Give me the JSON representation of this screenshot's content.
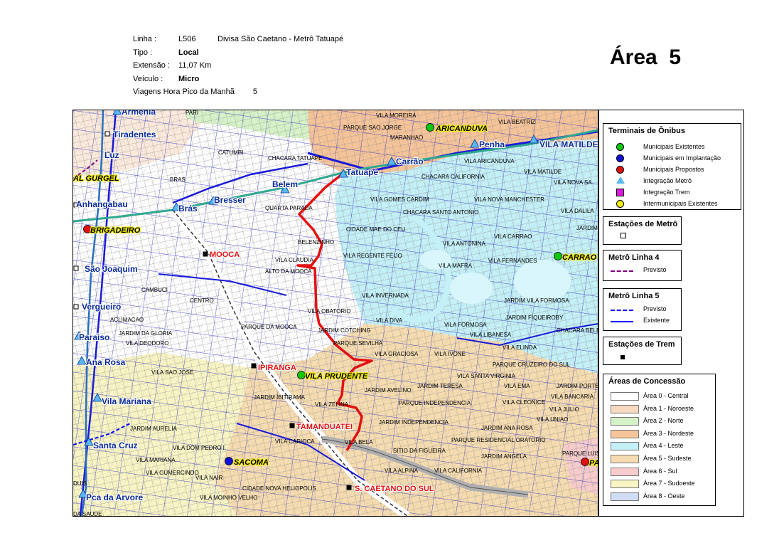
{
  "header": {
    "linha_label": "Linha :",
    "linha_code": "L506",
    "linha_name": "Divisa São Caetano - Metrô Tatuapé",
    "tipo_label": "Tipo :",
    "tipo_value": "Local",
    "extensao_label": "Extensão :",
    "extensao_value": "11,07",
    "extensao_unit": "Km",
    "veiculo_label": "Veículo :",
    "veiculo_value": "Micro",
    "viagens_label": "Viagens Hora Pico da Manhã",
    "viagens_value": "5"
  },
  "area_title": "Área  5",
  "map": {
    "stations": [
      {
        "name": "Armenia",
        "type": "metro"
      },
      {
        "name": "Tiradentes",
        "type": "metro-square"
      },
      {
        "name": "Luz",
        "type": "metro-square"
      },
      {
        "name": "AL GURGEL",
        "type": "terminal-label"
      },
      {
        "name": "Anhangabau",
        "type": "metro-square"
      },
      {
        "name": "Brás",
        "type": "metro"
      },
      {
        "name": "Bresser",
        "type": "metro"
      },
      {
        "name": "Belem",
        "type": "metro"
      },
      {
        "name": "Tatuape",
        "type": "metro"
      },
      {
        "name": "Carrão",
        "type": "metro"
      },
      {
        "name": "Penha",
        "type": "metro"
      },
      {
        "name": "VILA MATILDE",
        "type": "metro"
      },
      {
        "name": "São Joaquim",
        "type": "metro-square"
      },
      {
        "name": "Vergueiro",
        "type": "metro-square"
      },
      {
        "name": "Paraiso",
        "type": "metro"
      },
      {
        "name": "Ana Rosa",
        "type": "metro"
      },
      {
        "name": "Vila Mariana",
        "type": "metro"
      },
      {
        "name": "Santa Cruz",
        "type": "metro"
      },
      {
        "name": "Pca da Arvore",
        "type": "metro"
      }
    ],
    "terminals": [
      {
        "name": "ARICANDUVA",
        "color": "green"
      },
      {
        "name": "BRIGADEIRO",
        "color": "red"
      },
      {
        "name": "CARRAO",
        "color": "green"
      },
      {
        "name": "VILA PRUDENTE",
        "color": "green"
      },
      {
        "name": "SACOMA",
        "color": "blue"
      },
      {
        "name": "PA",
        "color": "red"
      }
    ],
    "train_stations": [
      "MOOCA",
      "IPIRANGA",
      "TAMANDUATEI",
      "S. CAETANO DO SUL"
    ],
    "neighborhoods": [
      "VILA MOREIRA",
      "PARQUE SAO JORGE",
      "MARANHAO",
      "VILA BEATRIZ",
      "PARI",
      "CATUMBI",
      "CHACARA TATUAPE",
      "BRAS",
      "QUARTA PARADA",
      "VILA ARICANDUVA",
      "CHACARA CALIFORNIA",
      "VILA MATILDE",
      "VILA NOVA SA",
      "VILA GOMES CARDIM",
      "VILA NOVA MANCHESTER",
      "CHACARA SANTO ANTONIO",
      "VILA DALILA",
      "CIDADE MAE DO CEU",
      "BELENZINHO",
      "VILA REGENTE FEIJO",
      "VILA ANTONINA",
      "VILA CARRAO",
      "JARDIM",
      "VILA CLAUDIA",
      "ALTO DA MOOCA",
      "VILA MAFRA",
      "VILA FERNANDES",
      "CAMBUCI",
      "CENTRO",
      "VILA INVERNADA",
      "JARDIM VILA FORMOSA",
      "ACLIMACAO",
      "VILA OBATORIO",
      "PARQUE DA MOOCA",
      "VILA DIVA",
      "VILA FORMOSA",
      "JARDIM FIQUEIROBY",
      "JARDIM COTCHING",
      "VILA LIBANESA",
      "CHACARA BELENZINHO",
      "JARDIM DA GLORIA",
      "VILA DEODORO",
      "PARQUE SEVILHA",
      "VILA GRACIOSA",
      "VILA IVONE",
      "VILA ELINDA",
      "PARQUE CRUZEIRO DO SUL",
      "VILA SAO JOSE",
      "VILA SANTA VIRGINIA",
      "JARDIM TERESA",
      "VILA EMA",
      "JARDIM PORTEIRA GRANDE",
      "JARDIM IBITIRAMA",
      "JARDIM AVELINO",
      "PARQUE INDEPENDENCIA",
      "VILA CLEONICE",
      "VILA BANCARIA",
      "VILA ZELINA",
      "VILA JULIO",
      "JARDIM AURELIA",
      "JARDIM INDEPENDENCIA",
      "JARDIM ANA ROSA",
      "VILA UNIAO",
      "VILA DOM PEDRO I",
      "VILA CARIOCA",
      "VILA BELA",
      "PARQUE RESIDENCIAL ORATORIO",
      "SITIO DA FIGUEIRA",
      "JARDIM ANGELA",
      "PARQUE LUIS MO",
      "VILA MARIANA",
      "VILA GUMERCINDO",
      "VILA NAIR",
      "VILA ALPINA",
      "VILA CALIFORNIA",
      "CIDADE NOVA HELIOPOLIS",
      "VILA MOINHO VELHO",
      "DA SAUDE",
      "DUIS"
    ]
  },
  "legend": {
    "terminais": {
      "title": "Terminais de Ônibus",
      "items": [
        {
          "label": "Municipais Existentes",
          "color": "#10c810",
          "shape": "circle"
        },
        {
          "label": "Municipais em Implantação",
          "color": "#1010d8",
          "shape": "circle"
        },
        {
          "label": "Municipais Propostos",
          "color": "#e01010",
          "shape": "circle"
        },
        {
          "label": "Integração Metrô",
          "color": "#5ab8f0",
          "shape": "triangle"
        },
        {
          "label": "Integração Trem",
          "color": "#e018e0",
          "shape": "square"
        },
        {
          "label": "Intermunicipais Existentes",
          "color": "#f0f010",
          "shape": "circle"
        }
      ]
    },
    "estacoes_metro": {
      "title": "Estações de Metrô"
    },
    "metro4": {
      "title": "Metrô Linha 4",
      "items": [
        {
          "label": "Previsto",
          "color": "#800080"
        }
      ]
    },
    "metro5": {
      "title": "Metrô Linha 5",
      "items": [
        {
          "label": "Previsto",
          "color": "#0000ff"
        },
        {
          "label": "Existente",
          "color": "#0000ff"
        }
      ]
    },
    "estacoes_trem": {
      "title": "Estações de Trem"
    },
    "areas": {
      "title": "Áreas de Concessão",
      "items": [
        {
          "label": "Área 0 - Central",
          "color": "#ffffff"
        },
        {
          "label": "Área 1 - Noroeste",
          "color": "#f7d9c0"
        },
        {
          "label": "Área 2 - Norte",
          "color": "#d6f2c8"
        },
        {
          "label": "Área 3 - Nordeste",
          "color": "#f6c499"
        },
        {
          "label": "Área 4 - Leste",
          "color": "#c4f0f8"
        },
        {
          "label": "Área 5 - Sudeste",
          "color": "#f6dcb0"
        },
        {
          "label": "Área 6 - Sul",
          "color": "#f8cccc"
        },
        {
          "label": "Área 7 - Sudoeste",
          "color": "#f8f4c4"
        },
        {
          "label": "Área 8 - Oeste",
          "color": "#cfdcf4"
        }
      ]
    }
  }
}
